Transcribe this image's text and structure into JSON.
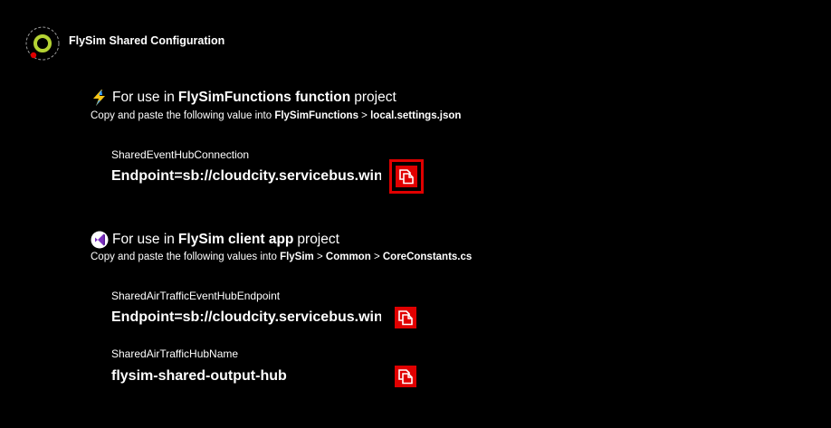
{
  "app": {
    "title": "FlySim Shared Configuration",
    "logo_icon": "ring-logo-icon",
    "colors": {
      "logo_ring": "#b5d334",
      "logo_dot": "#e00000",
      "accent": "#e00000"
    }
  },
  "functions_section": {
    "icon": "lightning-icon",
    "heading_prefix": "For use in",
    "heading_project": "FlySimFunctions function",
    "heading_suffix": "project",
    "instruction_prefix": "Copy and paste the following value into",
    "path": [
      "FlySimFunctions",
      "local.settings.json"
    ],
    "path_separator": ">",
    "fields": [
      {
        "label": "SharedEventHubConnection",
        "value": "Endpoint=sb://cloudcity.servicebus.windows.net/",
        "copy_icon": "copy-icon"
      }
    ]
  },
  "client_section": {
    "icon": "visual-studio-icon",
    "heading_prefix": "For use in",
    "heading_project": "FlySim client app",
    "heading_suffix": "project",
    "instruction_prefix": "Copy and paste the following values into",
    "path": [
      "FlySim",
      "Common",
      "CoreConstants.cs"
    ],
    "path_separator": ">",
    "fields": [
      {
        "label": "SharedAirTrafficEventHubEndpoint",
        "value": "Endpoint=sb://cloudcity.servicebus.windows.net/",
        "copy_icon": "copy-icon"
      },
      {
        "label": "SharedAirTrafficHubName",
        "value": "flysim-shared-output-hub",
        "copy_icon": "copy-icon"
      }
    ]
  }
}
